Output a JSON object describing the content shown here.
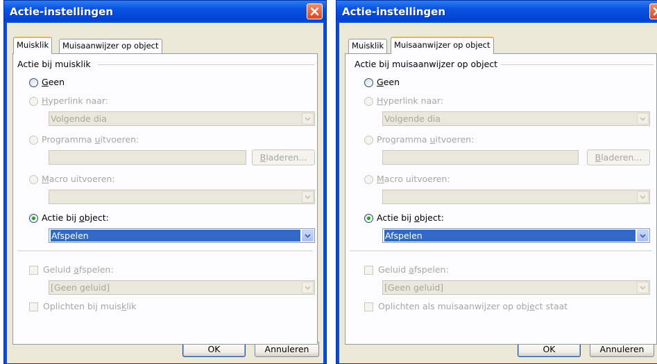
{
  "dialog1": {
    "title": "Actie-instellingen",
    "tabs": [
      "Muisklik",
      "Muisaanwijzer op object"
    ],
    "active_tab": "Muisklik",
    "group_label": "Actie bij muisklik",
    "opt_none": {
      "pre": "",
      "ul": "G",
      "post": "een"
    },
    "opt_hyperlink": {
      "pre": "",
      "ul": "H",
      "post": "yperlink naar:"
    },
    "hyperlink_value": "Volgende dia",
    "opt_program": {
      "pre": "Programma ",
      "ul": "u",
      "post": "itvoeren:"
    },
    "program_value": "",
    "browse": {
      "pre": "",
      "ul": "B",
      "post": "laderen..."
    },
    "opt_macro": {
      "pre": "",
      "ul": "M",
      "post": "acro uitvoeren:"
    },
    "macro_value": "",
    "opt_object": {
      "pre": "Actie bij ",
      "ul": "o",
      "post": "bject:"
    },
    "object_value": "Afspelen",
    "sound": {
      "pre": "Geluid ",
      "ul": "a",
      "post": "fspelen:"
    },
    "sound_value": "[Geen geluid]",
    "highlight": {
      "pre": "Oplichten bij muis",
      "ul": "k",
      "post": "lik"
    },
    "ok": "OK",
    "cancel": "Annuleren",
    "selected_option": "object"
  },
  "dialog2": {
    "title": "Actie-instellingen",
    "tabs": [
      "Muisklik",
      "Muisaanwijzer op object"
    ],
    "active_tab": "Muisaanwijzer op object",
    "group_label": "Actie bij muisaanwijzer op object",
    "opt_none": {
      "pre": "",
      "ul": "G",
      "post": "een"
    },
    "opt_hyperlink": {
      "pre": "",
      "ul": "H",
      "post": "yperlink naar:"
    },
    "hyperlink_value": "Volgende dia",
    "opt_program": {
      "pre": "Programma ",
      "ul": "u",
      "post": "itvoeren:"
    },
    "program_value": "",
    "browse": {
      "pre": "",
      "ul": "B",
      "post": "laderen..."
    },
    "opt_macro": {
      "pre": "",
      "ul": "M",
      "post": "acro uitvoeren:"
    },
    "macro_value": "",
    "opt_object": {
      "pre": "Actie bij ",
      "ul": "o",
      "post": "bject:"
    },
    "object_value": "Afspelen",
    "sound": {
      "pre": "Geluid ",
      "ul": "a",
      "post": "fspelen:"
    },
    "sound_value": "[Geen geluid]",
    "highlight": {
      "pre": "Oplichten als muisaanwijzer op obj",
      "ul": "e",
      "post": "ct staat"
    },
    "ok": "OK",
    "cancel": "Annuleren",
    "selected_option": "object"
  },
  "colors": {
    "titlebar": "#0a55e3",
    "dialog_face": "#ece9d8",
    "selection": "#316ac5",
    "radio_dot": "#21a121",
    "close_button": "#d9471f"
  }
}
